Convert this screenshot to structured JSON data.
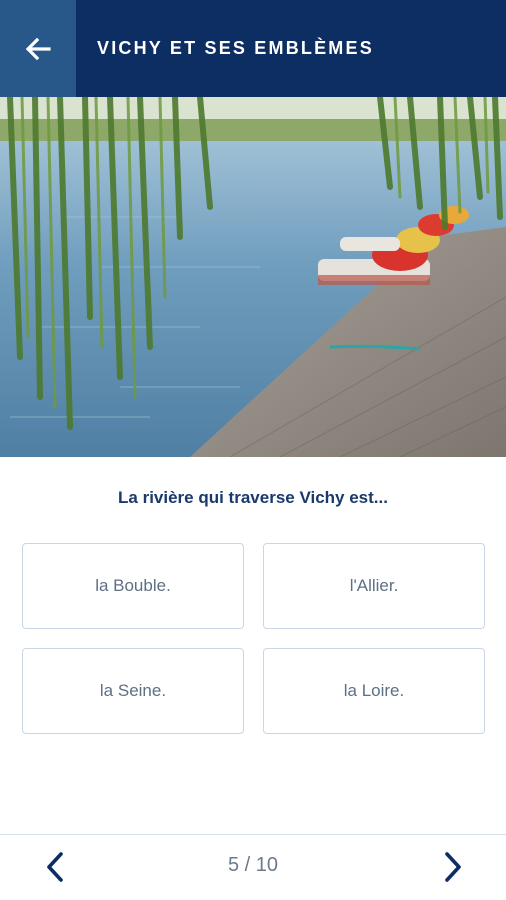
{
  "header": {
    "title": "VICHY ET SES EMBLÈMES",
    "back_icon": "arrow-left-icon",
    "color": "#0d2e63",
    "back_bg": "#28578a"
  },
  "image": {
    "subject": "river-dock-with-pedal-boats"
  },
  "quiz": {
    "question": "La rivière qui traverse Vichy est...",
    "answers": [
      "la Bouble.",
      "l'Allier.",
      "la Seine.",
      "la Loire."
    ]
  },
  "footer": {
    "progress": "5 / 10",
    "current": 5,
    "total": 10,
    "prev_icon": "chevron-left-icon",
    "next_icon": "chevron-right-icon"
  }
}
